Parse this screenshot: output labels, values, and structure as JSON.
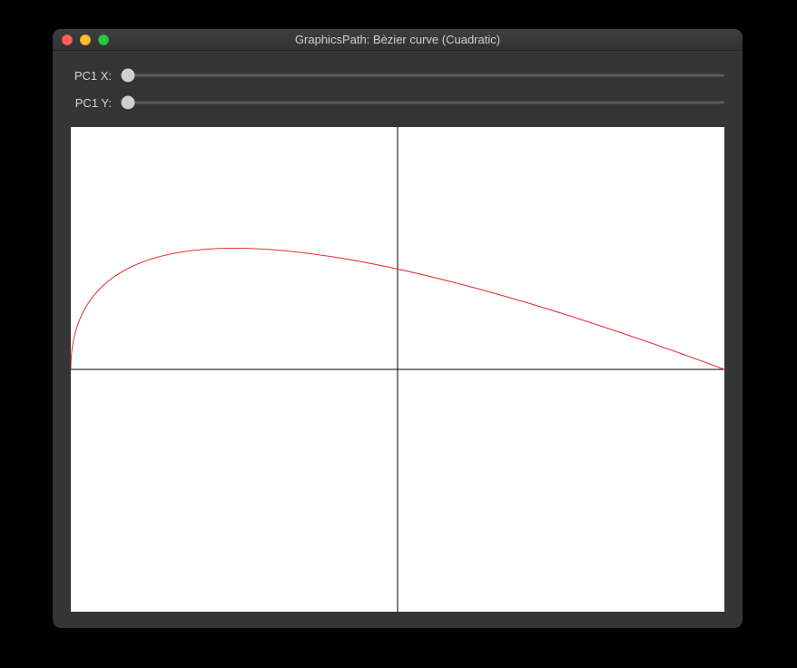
{
  "window": {
    "title": "GraphicsPath: Bèzier curve (Cuadratic)"
  },
  "sliders": {
    "pc1x": {
      "label": "PC1 X:",
      "value": 0,
      "min": 0,
      "max": 100
    },
    "pc1y": {
      "label": "PC1 Y:",
      "value": 0,
      "min": 0,
      "max": 100
    }
  },
  "chart_data": {
    "type": "line",
    "title": "",
    "xlabel": "",
    "ylabel": "",
    "xlim": [
      -1,
      1
    ],
    "ylim": [
      -1,
      1
    ],
    "grid": false,
    "axes": {
      "x0": 0,
      "y0": 0
    },
    "bezier": {
      "kind": "quadratic",
      "p0": {
        "x": -1,
        "y": 0
      },
      "p1": {
        "x": -1,
        "y": 1
      },
      "p2": {
        "x": 1,
        "y": 0
      }
    },
    "curve_color": "#e03232"
  }
}
